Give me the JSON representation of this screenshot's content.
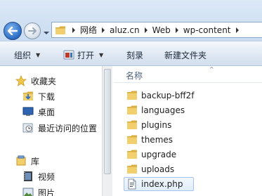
{
  "address": {
    "crumbs": [
      "网络",
      "aluz.cn",
      "Web",
      "wp-content"
    ]
  },
  "commands": {
    "organize": "组织",
    "open": "打开",
    "burn": "刻录",
    "new_folder": "新建文件夹"
  },
  "nav": {
    "favorites": "收藏夹",
    "downloads": "下载",
    "desktop": "桌面",
    "recent": "最近访问的位置",
    "libraries": "库",
    "videos": "视频",
    "pictures": "图片"
  },
  "content": {
    "column_name": "名称",
    "items": [
      {
        "name": "backup-bff2f",
        "type": "folder"
      },
      {
        "name": "languages",
        "type": "folder"
      },
      {
        "name": "plugins",
        "type": "folder"
      },
      {
        "name": "themes",
        "type": "folder"
      },
      {
        "name": "upgrade",
        "type": "folder"
      },
      {
        "name": "uploads",
        "type": "folder"
      },
      {
        "name": "index.php",
        "type": "file",
        "selected": true
      }
    ]
  },
  "colors": {
    "folder": "#e8c15a",
    "accent": "#2b6cc4"
  }
}
